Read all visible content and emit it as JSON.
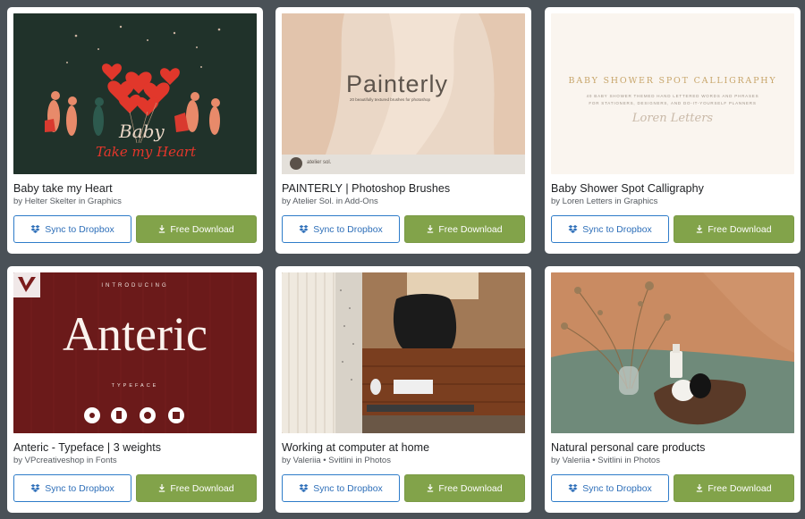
{
  "cards": [
    {
      "title": "Baby take my Heart",
      "byline": "by Helter Skelter in Graphics",
      "art_text_1": "Baby",
      "art_text_2": "Take my Heart",
      "sync_label": "Sync to Dropbox",
      "download_label": "Free Download"
    },
    {
      "title": "PAINTERLY | Photoshop Brushes",
      "byline": "by Atelier Sol. in Add-Ons",
      "art_text_1": "Painterly",
      "art_text_2": "20 beautifully textured brushes for photoshop",
      "art_text_3": "atelier sol.",
      "sync_label": "Sync to Dropbox",
      "download_label": "Free Download"
    },
    {
      "title": "Baby Shower Spot Calligraphy",
      "byline": "by Loren Letters in Graphics",
      "art_text_1": "BABY SHOWER SPOT CALLIGRAPHY",
      "art_text_2": "40 BABY SHOWER THEMED HAND LETTERED WORDS AND PHRASES",
      "art_text_3": "FOR STATIONERS, DESIGNERS, AND DO-IT-YOURSELF PLANNERS",
      "art_text_4": "Loren Letters",
      "sync_label": "Sync to Dropbox",
      "download_label": "Free Download"
    },
    {
      "title": "Anteric - Typeface | 3 weights",
      "byline": "by VPcreativeshop in Fonts",
      "art_text_1": "INTRODUCING",
      "art_text_2": "Anteric",
      "art_text_3": "TYPEFACE",
      "sync_label": "Sync to Dropbox",
      "download_label": "Free Download"
    },
    {
      "title": "Working at computer at home",
      "byline": "by Valeriia • Svitlini in Photos",
      "sync_label": "Sync to Dropbox",
      "download_label": "Free Download"
    },
    {
      "title": "Natural personal care products",
      "byline": "by Valeriia • Svitlini in Photos",
      "sync_label": "Sync to Dropbox",
      "download_label": "Free Download"
    }
  ],
  "icons": {
    "sync": "dropbox-icon",
    "download": "download-icon"
  },
  "colors": {
    "page_bg": "#4a5157",
    "sync_border": "#2e7cc9",
    "download_bg": "#82a34a"
  }
}
